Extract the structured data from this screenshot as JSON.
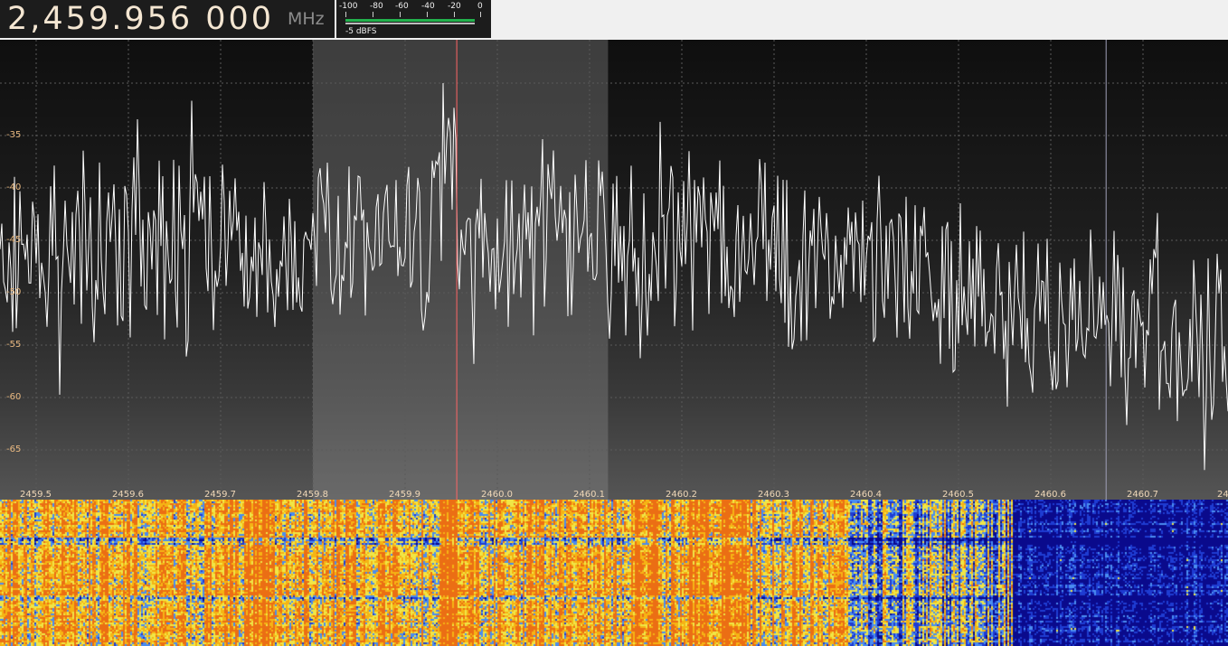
{
  "frequency": {
    "digits": "2,459.956 000",
    "unit": "MHz"
  },
  "meter": {
    "scale_labels": [
      "-100",
      "-80",
      "-60",
      "-40",
      "-20",
      "0"
    ],
    "dbfs_label": "-5 dBFS",
    "level_fraction": 0.95
  },
  "spectrum": {
    "y_labels": [
      "-35",
      "-40",
      "-45",
      "-50",
      "-55",
      "-60",
      "-65"
    ],
    "x_labels": [
      "2459.5",
      "2459.6",
      "2459.7",
      "2459.8",
      "2459.9",
      "2460.0",
      "2460.1",
      "2460.2",
      "2460.3",
      "2460.4",
      "2460.5",
      "2460.6",
      "2460.7",
      "24"
    ],
    "filter_range_mhz": [
      2459.8,
      2460.12
    ],
    "tuned_frequency_mhz": 2459.956,
    "marker_frequency_mhz": 2460.66,
    "colors": {
      "trace": "#ffffff",
      "tuned_line": "#ff6666",
      "marker_line": "#a0a0b8",
      "filter_band": "#8c8c8c",
      "grid": "#5a5a5a"
    }
  },
  "waterfall": {
    "palette": [
      "#0a0a8c",
      "#1e3cd2",
      "#4a8cf0",
      "#f0e646",
      "#f5b414",
      "#eb6e14"
    ]
  }
}
